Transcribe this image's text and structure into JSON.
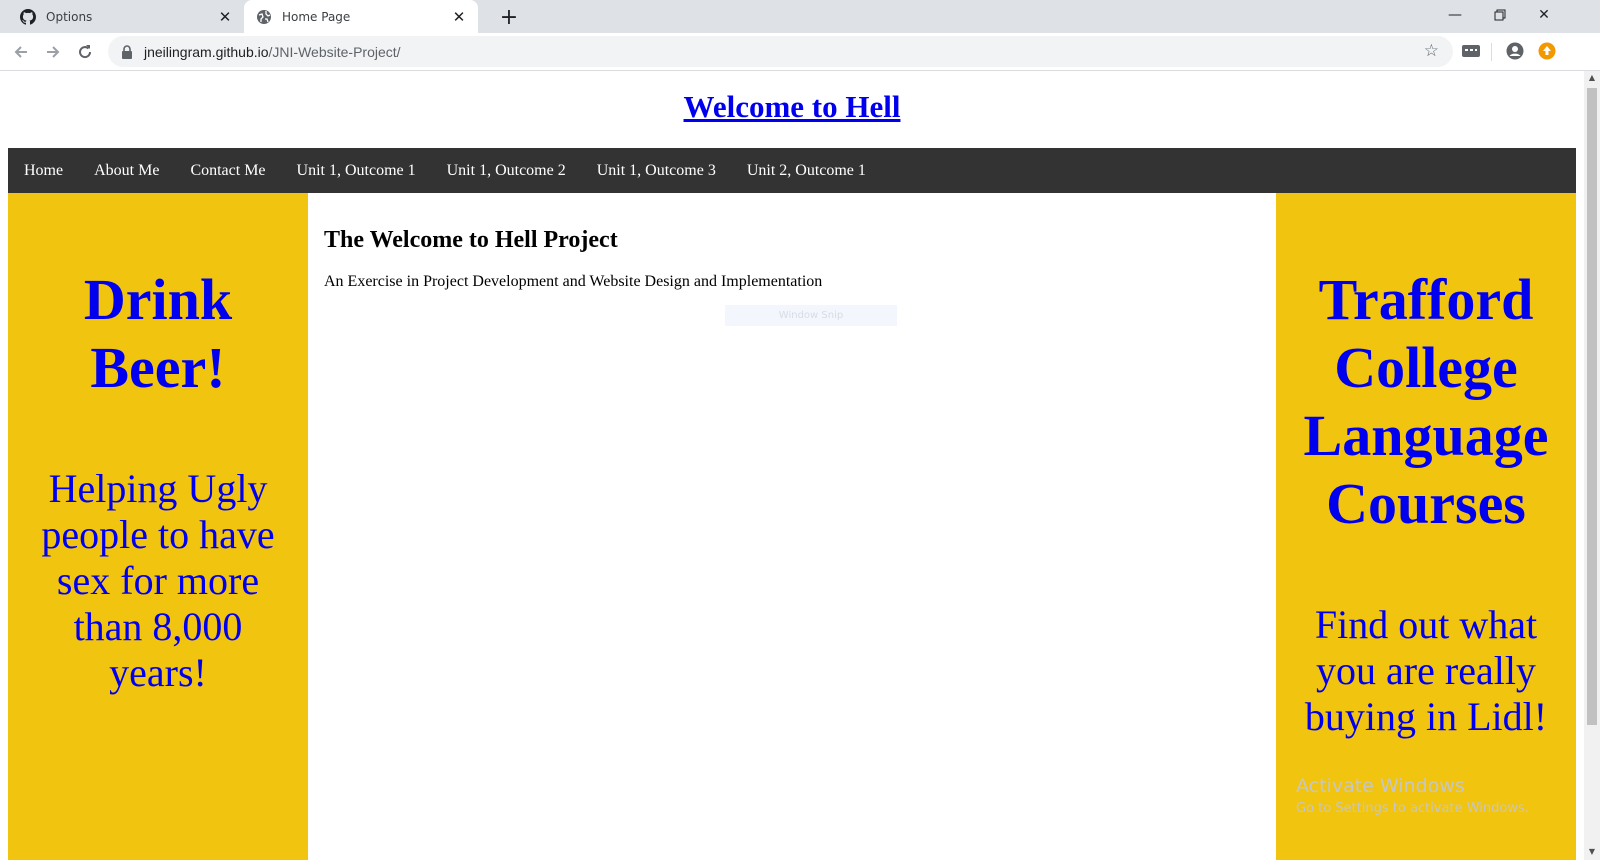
{
  "browser": {
    "tabs": [
      {
        "title": "Options",
        "icon": "github-icon",
        "active": false
      },
      {
        "title": "Home Page",
        "icon": "globe-icon",
        "active": true
      }
    ],
    "address": {
      "domain": "jneilingram.github.io",
      "path": "/JNI-Website-Project/"
    }
  },
  "page": {
    "title": "Welcome to Hell",
    "nav": [
      "Home",
      "About Me",
      "Contact Me",
      "Unit 1, Outcome 1",
      "Unit 1, Outcome 2",
      "Unit 1, Outcome 3",
      "Unit 2, Outcome 1"
    ],
    "left_ad": {
      "headline": [
        "Drink",
        "Beer!"
      ],
      "body": [
        "Helping Ugly",
        "people to have",
        "sex for more",
        "than 8,000",
        "years!"
      ]
    },
    "right_ad": {
      "headline": [
        "Trafford",
        "College",
        "Language",
        "Courses"
      ],
      "body": [
        "Find out what",
        "you are really",
        "buying in Lidl!"
      ]
    },
    "main": {
      "heading": "The Welcome to Hell Project",
      "subtitle": "An Exercise in Project Development and Website Design and Implementation"
    }
  },
  "overlays": {
    "snip_label": "Window Snip",
    "activation_title": "Activate Windows",
    "activation_text": "Go to Settings to activate Windows."
  },
  "colors": {
    "ad_background": "#f1c40f",
    "ad_text": "#0000ee",
    "navbar": "#333333"
  }
}
